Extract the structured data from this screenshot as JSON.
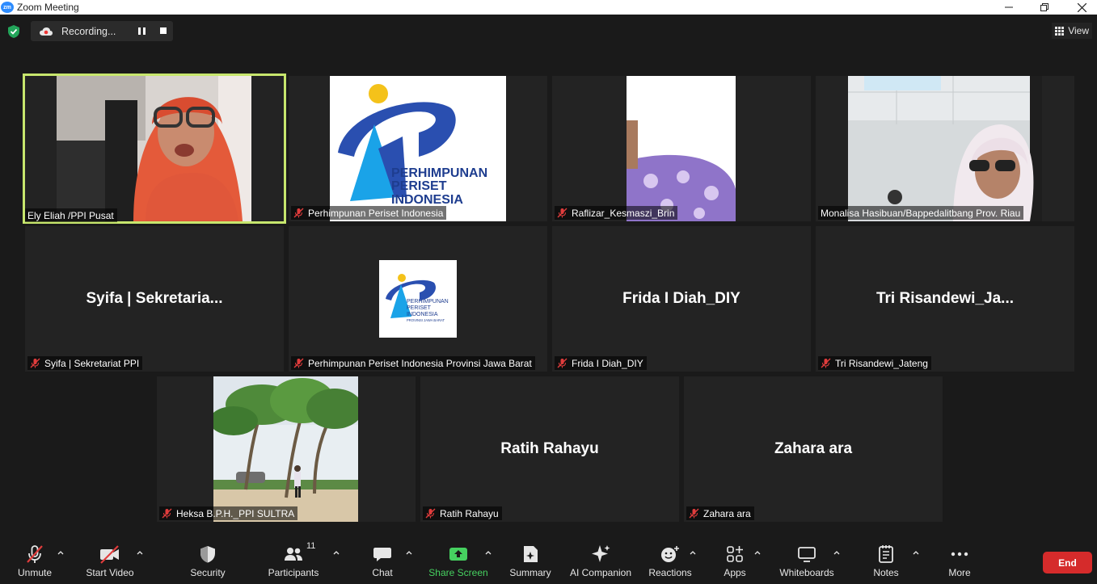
{
  "window": {
    "title": "Zoom Meeting",
    "app_badge": "zm"
  },
  "recording": {
    "label": "Recording..."
  },
  "view_label": "View",
  "tiles": [
    {
      "name": "Ely Eliah /PPI Pusat",
      "muted": false,
      "active": true
    },
    {
      "name": "Perhimpunan Periset Indonesia",
      "muted": true
    },
    {
      "name": "Raflizar_Kesmaszi_Brin",
      "muted": true
    },
    {
      "name": "Monalisa Hasibuan/Bappedalitbang Prov. Riau",
      "muted": false
    },
    {
      "name": "Syifa | Sekretariat PPI",
      "display": "Syifa | Sekretaria...",
      "muted": true
    },
    {
      "name": "Perhimpunan Periset Indonesia Provinsi Jawa Barat",
      "muted": true
    },
    {
      "name": "Frida I Diah_DIY",
      "display": "Frida I Diah_DIY",
      "muted": true
    },
    {
      "name": "Tri Risandewi_Jateng",
      "display": "Tri  Risandewi_Ja...",
      "muted": true
    },
    {
      "name": "Heksa B.P.H._PPI SULTRA",
      "muted": true
    },
    {
      "name": "Ratih Rahayu",
      "display": "Ratih Rahayu",
      "muted": true
    },
    {
      "name": "Zahara ara",
      "display": "Zahara ara",
      "muted": true
    }
  ],
  "logo_text": {
    "line1": "PERHIMPUNAN",
    "line2": "PERISET",
    "line3": "INDONESIA",
    "line4": "PROVINSI JAWA BARAT"
  },
  "toolbar": {
    "unmute": "Unmute",
    "start_video": "Start Video",
    "security": "Security",
    "participants": "Participants",
    "participants_count": "11",
    "chat": "Chat",
    "share_screen": "Share Screen",
    "summary": "Summary",
    "ai_companion": "AI Companion",
    "reactions": "Reactions",
    "apps": "Apps",
    "whiteboards": "Whiteboards",
    "notes": "Notes",
    "more": "More",
    "end": "End"
  },
  "colors": {
    "active_speaker": "#c7e66d",
    "end_button": "#d52b2b",
    "share_green": "#46d160",
    "logo_blue": "#2a4fb0",
    "logo_light_blue": "#1aa3e8",
    "logo_yellow": "#f4c21a"
  }
}
